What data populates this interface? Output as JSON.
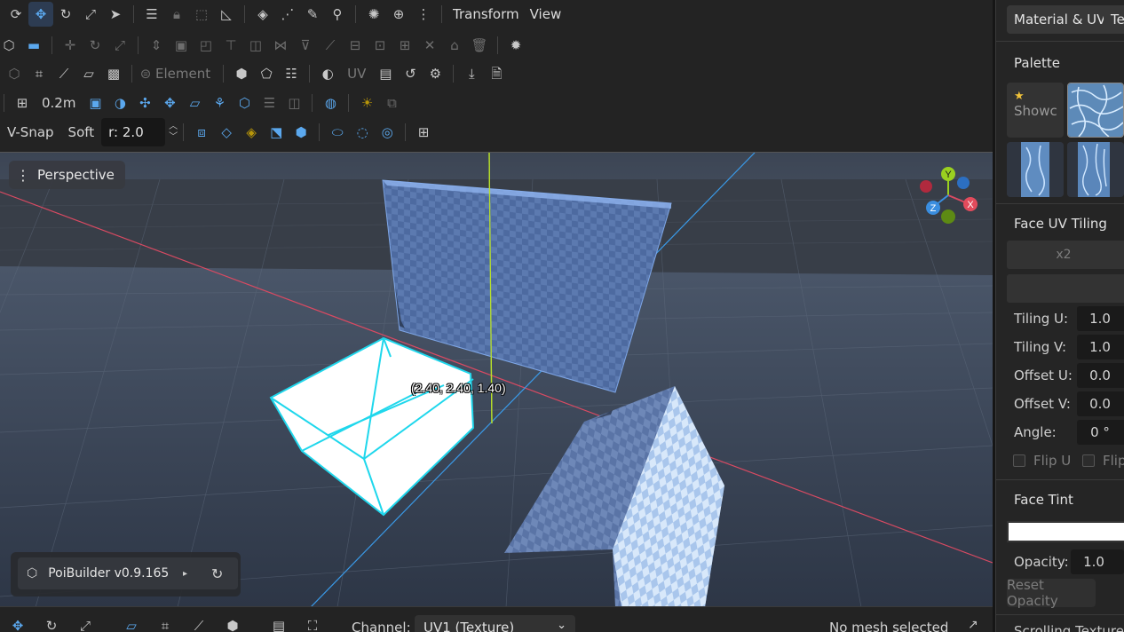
{
  "toolbar": {
    "row1": {
      "menus": [
        "Transform",
        "View"
      ]
    },
    "row3": {
      "element_label": "Element",
      "uv_label": "UV"
    },
    "row4": {
      "grid_size": "0.2m"
    },
    "row5": {
      "vsnap_label": "V-Snap",
      "soft_label": "Soft",
      "radius_value": "r: 2.0"
    }
  },
  "viewport": {
    "camera_label": "Perspective",
    "coordinate_readout": "(2.40, 2.40, 1.40)",
    "gizmo": {
      "y": "Y",
      "x": "X",
      "z": "Z"
    },
    "version": "PoiBuilder v0.9.165"
  },
  "bottom_bar": {
    "channel_label": "Channel:",
    "channel_value": "UV1 (Texture)",
    "status": "No mesh selected"
  },
  "panel": {
    "tabs": [
      "Material & UV",
      "Te"
    ],
    "palette_title": "Palette",
    "showcase_label": "Showc",
    "face_uv_title": "Face UV Tiling",
    "x2_label": "x2",
    "props": [
      {
        "label": "Tiling U:",
        "value": "1.0"
      },
      {
        "label": "Tiling V:",
        "value": "1.0"
      },
      {
        "label": "Offset U:",
        "value": "0.0"
      },
      {
        "label": "Offset V:",
        "value": "0.0"
      },
      {
        "label": "Angle:",
        "value": "0 °"
      }
    ],
    "flip_u": "Flip U",
    "flip_v": "Flip",
    "face_tint_title": "Face Tint",
    "tint_color": "#ffffff",
    "opacity_label": "Opacity:",
    "opacity_value": "1.0",
    "reset_opacity": "Reset Opacity",
    "next_section": "Scrolling Texture"
  },
  "colors": {
    "accent": "#5ba8ee",
    "selection": "#22d3e6",
    "axis_x": "#d94a62",
    "axis_y": "#b8e02a",
    "axis_z": "#3a9ae8"
  }
}
